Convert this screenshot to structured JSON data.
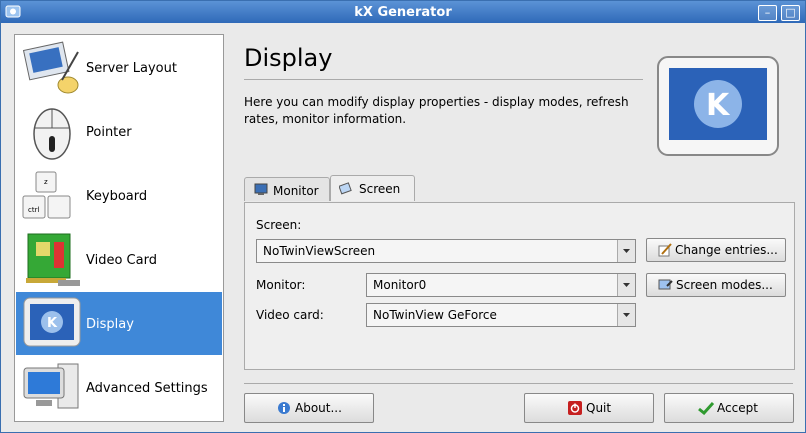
{
  "window": {
    "title": "kX Generator"
  },
  "sidebar": {
    "items": [
      {
        "label": "Server Layout",
        "icon": "server-layout-icon",
        "selected": false
      },
      {
        "label": "Pointer",
        "icon": "mouse-icon",
        "selected": false
      },
      {
        "label": "Keyboard",
        "icon": "keyboard-icon",
        "selected": false
      },
      {
        "label": "Video Card",
        "icon": "video-card-icon",
        "selected": false
      },
      {
        "label": "Display",
        "icon": "display-monitor-icon",
        "selected": true
      },
      {
        "label": "Advanced Settings",
        "icon": "computer-icon",
        "selected": false
      }
    ]
  },
  "main": {
    "heading": "Display",
    "description": "Here you can modify display properties - display modes, refresh rates, monitor information.",
    "tabs": [
      {
        "label": "Monitor",
        "active": false
      },
      {
        "label": "Screen",
        "active": true
      }
    ],
    "screen_label": "Screen:",
    "screen_value": "NoTwinViewScreen",
    "monitor_label": "Monitor:",
    "monitor_value": "Monitor0",
    "videocard_label": "Video card:",
    "videocard_value": "NoTwinView GeForce",
    "change_entries": "Change entries...",
    "screen_modes": "Screen modes..."
  },
  "buttons": {
    "about": "About...",
    "quit": "Quit",
    "accept": "Accept"
  },
  "colors": {
    "titlebar": "#2f69b8",
    "selection": "#3f88d8"
  }
}
